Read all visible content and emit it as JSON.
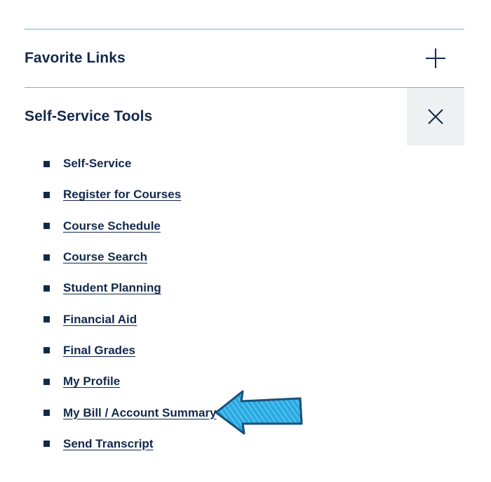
{
  "sections": [
    {
      "title": "Favorite Links",
      "toggle_icon": "plus-icon",
      "expanded": false
    },
    {
      "title": "Self-Service Tools",
      "toggle_icon": "close-icon",
      "expanded": true
    }
  ],
  "links": [
    {
      "label": "Self-Service"
    },
    {
      "label": "Register for Courses"
    },
    {
      "label": "Course Schedule"
    },
    {
      "label": "Course Search"
    },
    {
      "label": "Student Planning"
    },
    {
      "label": "Financial Aid"
    },
    {
      "label": "Final Grades"
    },
    {
      "label": "My Profile"
    },
    {
      "label": "My Bill / Account Summary"
    },
    {
      "label": "Send Transcript"
    }
  ],
  "annotation": {
    "icon": "arrow-left-icon",
    "color": "#29aae2",
    "points_to": "My Bill / Account Summary"
  },
  "colors": {
    "text": "#13294b",
    "divider": "#5bbfd0",
    "active_toggle_bg": "#eef1f2"
  }
}
